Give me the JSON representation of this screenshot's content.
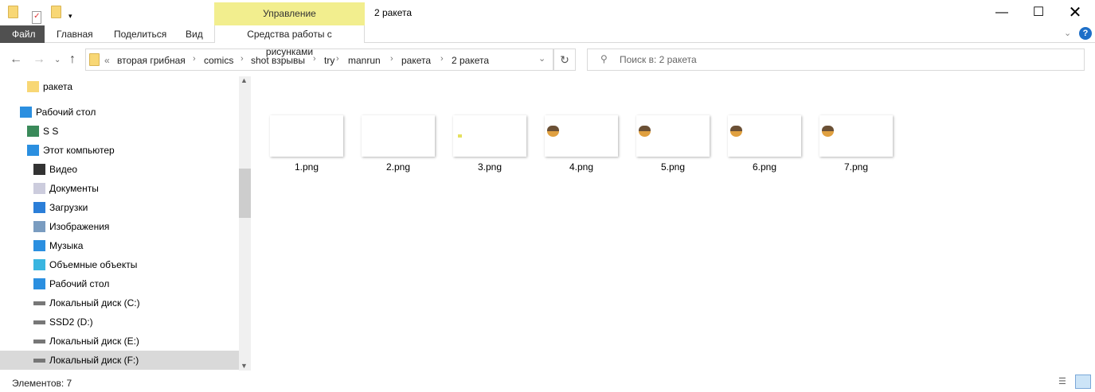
{
  "window": {
    "title": "2 ракета",
    "context_tab": "Управление"
  },
  "ribbon": {
    "tabs": [
      "Файл",
      "Главная",
      "Поделиться",
      "Вид",
      "Средства работы с рисунками"
    ]
  },
  "address": {
    "prefix": "«",
    "crumbs": [
      "вторая грибная",
      "comics",
      "shot взрывы",
      "try",
      "manrun",
      "ракета",
      "2 ракета"
    ]
  },
  "search": {
    "placeholder": "Поиск в: 2 ракета"
  },
  "tree": [
    {
      "label": "ракета",
      "icon": "folder-icon"
    },
    {
      "label": "Рабочий стол",
      "icon": "desktop-icon"
    },
    {
      "label": "S S",
      "icon": "user-icon"
    },
    {
      "label": "Этот компьютер",
      "icon": "computer-icon"
    },
    {
      "label": "Видео",
      "icon": "video-icon"
    },
    {
      "label": "Документы",
      "icon": "documents-icon"
    },
    {
      "label": "Загрузки",
      "icon": "downloads-icon"
    },
    {
      "label": "Изображения",
      "icon": "pictures-icon"
    },
    {
      "label": "Музыка",
      "icon": "music-icon"
    },
    {
      "label": "Объемные объекты",
      "icon": "3d-objects-icon"
    },
    {
      "label": "Рабочий стол",
      "icon": "desktop-icon"
    },
    {
      "label": "Локальный диск (C:)",
      "icon": "drive-icon"
    },
    {
      "label": "SSD2 (D:)",
      "icon": "drive-icon"
    },
    {
      "label": "Локальный диск (E:)",
      "icon": "drive-icon"
    },
    {
      "label": "Локальный диск (F:)",
      "icon": "drive-icon"
    }
  ],
  "files": [
    "1.png",
    "2.png",
    "3.png",
    "4.png",
    "5.png",
    "6.png",
    "7.png"
  ],
  "status": {
    "count": "Элементов: 7"
  }
}
